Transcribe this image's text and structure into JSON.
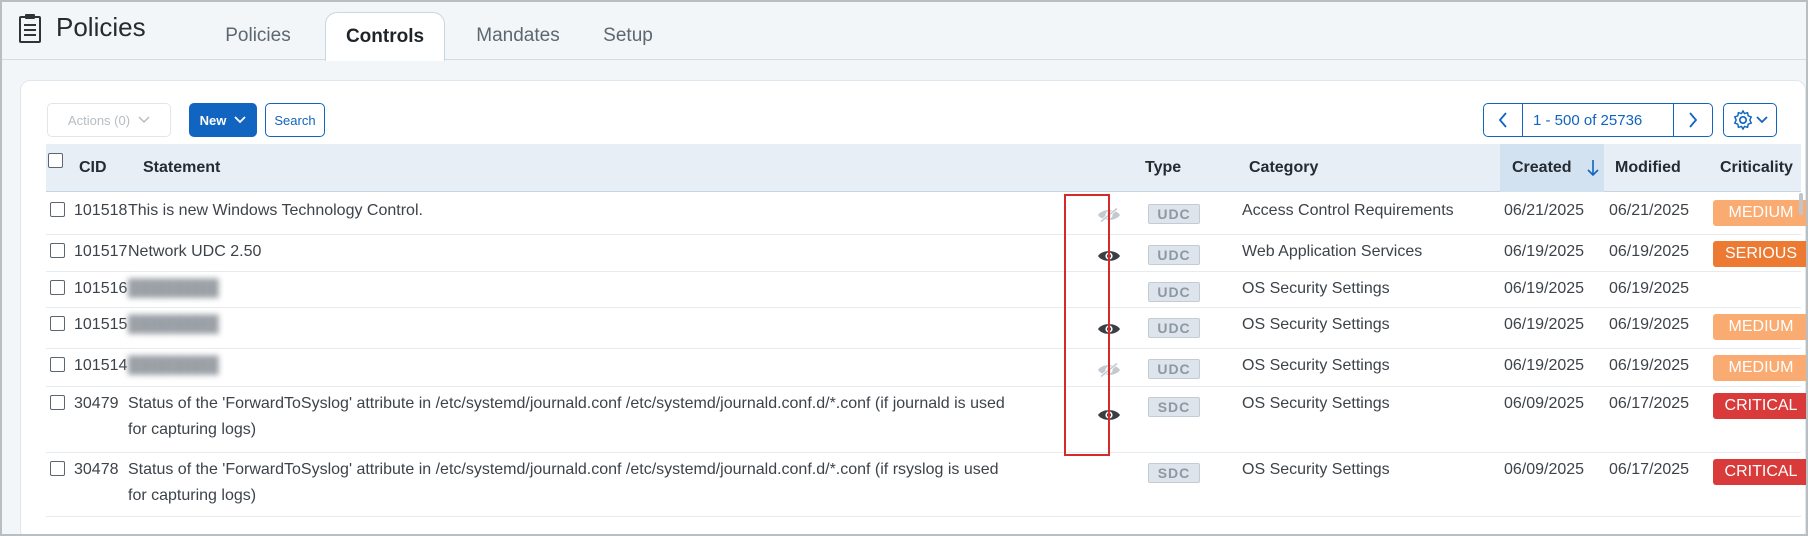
{
  "header": {
    "title": "Policies",
    "tabs": [
      {
        "label": "Policies",
        "active": false
      },
      {
        "label": "Controls",
        "active": true
      },
      {
        "label": "Mandates",
        "active": false
      },
      {
        "label": "Setup",
        "active": false
      }
    ]
  },
  "toolbar": {
    "actions_label": "Actions (0)",
    "new_label": "New",
    "search_label": "Search",
    "pager_text": "1 - 500 of 25736"
  },
  "table": {
    "columns": {
      "cid": "CID",
      "statement": "Statement",
      "type": "Type",
      "category": "Category",
      "created": "Created",
      "modified": "Modified",
      "criticality": "Criticality"
    },
    "sort_column": "Created",
    "sort_direction": "descending",
    "rows": [
      {
        "cid": "101518",
        "statement": "This is new Windows Technology Control.",
        "statement2": "",
        "blurred": false,
        "eye": "hidden",
        "type": "UDC",
        "category": "Access Control Requirements",
        "created": "06/21/2025",
        "modified": "06/21/2025",
        "criticality": "MEDIUM"
      },
      {
        "cid": "101517",
        "statement": "Network UDC 2.50",
        "statement2": "",
        "blurred": false,
        "eye": "visible",
        "type": "UDC",
        "category": "Web Application Services",
        "created": "06/19/2025",
        "modified": "06/19/2025",
        "criticality": "SERIOUS"
      },
      {
        "cid": "101516",
        "statement": "",
        "statement2": "",
        "blurred": true,
        "eye": "none",
        "type": "UDC",
        "category": "OS Security Settings",
        "created": "06/19/2025",
        "modified": "06/19/2025",
        "criticality": ""
      },
      {
        "cid": "101515",
        "statement": "",
        "statement2": "",
        "blurred": true,
        "eye": "visible",
        "type": "UDC",
        "category": "OS Security Settings",
        "created": "06/19/2025",
        "modified": "06/19/2025",
        "criticality": "MEDIUM"
      },
      {
        "cid": "101514",
        "statement": "",
        "statement2": "",
        "blurred": true,
        "eye": "hidden",
        "type": "UDC",
        "category": "OS Security Settings",
        "created": "06/19/2025",
        "modified": "06/19/2025",
        "criticality": "MEDIUM"
      },
      {
        "cid": "30479",
        "statement": "Status of the 'ForwardToSyslog' attribute in /etc/systemd/journald.conf /etc/systemd/journald.conf.d/*.conf (if journald is used",
        "statement2": "for capturing logs)",
        "blurred": false,
        "eye": "visible",
        "type": "SDC",
        "category": "OS Security Settings",
        "created": "06/09/2025",
        "modified": "06/17/2025",
        "criticality": "CRITICAL"
      },
      {
        "cid": "30478",
        "statement": "Status of the 'ForwardToSyslog' attribute in /etc/systemd/journald.conf /etc/systemd/journald.conf.d/*.conf (if rsyslog is used",
        "statement2": "for capturing logs)",
        "blurred": false,
        "eye": "none",
        "type": "SDC",
        "category": "OS Security Settings",
        "created": "06/09/2025",
        "modified": "06/17/2025",
        "criticality": "CRITICAL"
      }
    ]
  },
  "colors": {
    "accent": "#1164bf",
    "medium": "#f9ab71",
    "serious": "#ec7a33",
    "critical": "#d93a3a",
    "highlight_box": "#d62a2a"
  },
  "icons": {
    "logo": "document-list-icon",
    "eye_visible": "eye-icon",
    "eye_hidden": "eye-off-icon",
    "settings": "gear-icon",
    "sort": "arrow-down-icon"
  }
}
